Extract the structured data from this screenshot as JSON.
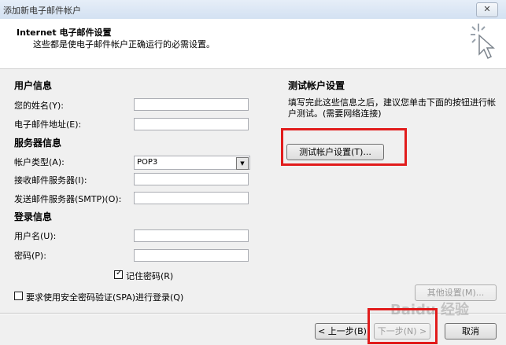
{
  "window": {
    "title": "添加新电子邮件帐户",
    "close_label": "✕"
  },
  "header": {
    "title": "Internet 电子邮件设置",
    "subtitle": "这些都是使电子邮件帐户正确运行的必需设置。"
  },
  "user_info": {
    "heading": "用户信息",
    "name_label": "您的姓名(Y):",
    "name_value": "",
    "email_label": "电子邮件地址(E):",
    "email_value": ""
  },
  "server_info": {
    "heading": "服务器信息",
    "account_type_label": "帐户类型(A):",
    "account_type_value": "POP3",
    "incoming_label": "接收邮件服务器(I):",
    "incoming_value": "",
    "outgoing_label": "发送邮件服务器(SMTP)(O):",
    "outgoing_value": ""
  },
  "login_info": {
    "heading": "登录信息",
    "username_label": "用户名(U):",
    "username_value": "",
    "password_label": "密码(P):",
    "password_value": "",
    "remember_label": "记住密码(R)",
    "remember_checked": true,
    "spa_label": "要求使用安全密码验证(SPA)进行登录(Q)",
    "spa_checked": false
  },
  "test_settings": {
    "heading": "测试帐户设置",
    "description": "填写完此这些信息之后，建议您单击下面的按钮进行帐户测试。(需要网络连接)",
    "button_label": "测试帐户设置(T)..."
  },
  "more_settings_label": "其他设置(M)...",
  "footer": {
    "back_label": "< 上一步(B)",
    "next_label": "下一步(N) >",
    "cancel_label": "取消"
  },
  "watermark": "Baidu 经验",
  "colors": {
    "highlight_box": "#e11c1c",
    "header_bg": "#ffffff",
    "dialog_bg": "#f0f0f0"
  }
}
